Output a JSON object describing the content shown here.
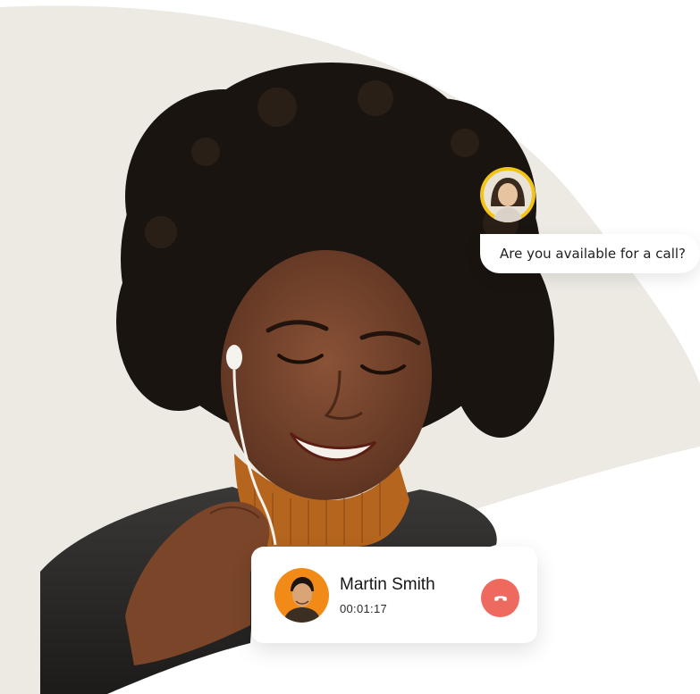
{
  "chat": {
    "message": "Are you available for a call?",
    "avatar_ring_color": "#f2c415"
  },
  "call": {
    "caller_name": "Martin Smith",
    "duration": "00:01:17",
    "avatar_bg_color": "#f28a18",
    "hangup_color": "#ee6a5e",
    "hangup_icon": "phone-hangup-icon"
  },
  "colors": {
    "background_shape": "#edeae4"
  }
}
